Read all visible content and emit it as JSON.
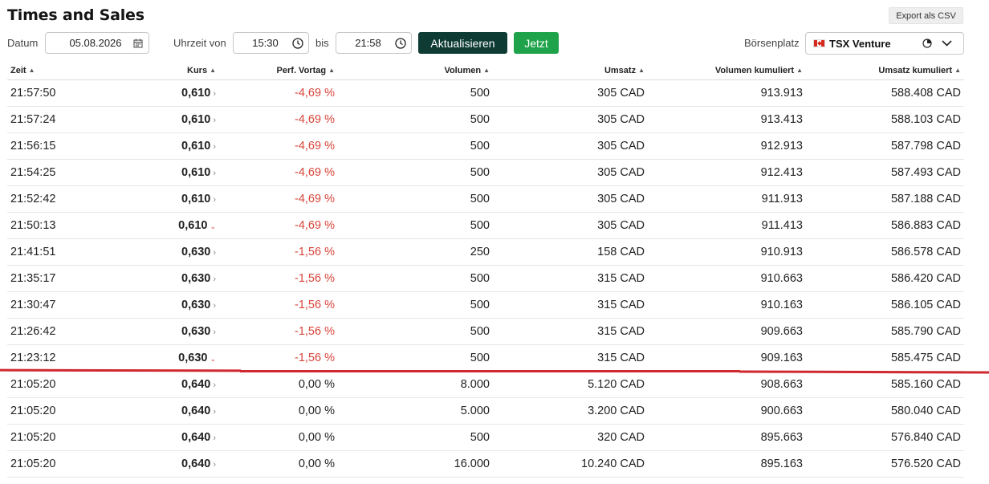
{
  "title": "Times and Sales",
  "export_label": "Export als CSV",
  "filters": {
    "date_label": "Datum",
    "date_value": "05.08.2026",
    "time_from_label": "Uhrzeit von",
    "time_from_value": "15:30",
    "time_to_label": "bis",
    "time_to_value": "21:58",
    "refresh_label": "Aktualisieren",
    "now_label": "Jetzt",
    "exchange_label": "Börsenplatz",
    "exchange_value": "TSX Venture"
  },
  "table": {
    "headers": [
      "Zeit",
      "Kurs",
      "Perf. Vortag",
      "Volumen",
      "Umsatz",
      "Volumen kumuliert",
      "Umsatz kumuliert"
    ],
    "rows": [
      {
        "zeit": "21:57:50",
        "kurs": "0,610",
        "trend": "neutral",
        "perf": "-4,69 %",
        "vol": "500",
        "umsatz": "305 CAD",
        "vol_kum": "913.913",
        "umsatz_kum": "588.408 CAD"
      },
      {
        "zeit": "21:57:24",
        "kurs": "0,610",
        "trend": "neutral",
        "perf": "-4,69 %",
        "vol": "500",
        "umsatz": "305 CAD",
        "vol_kum": "913.413",
        "umsatz_kum": "588.103 CAD"
      },
      {
        "zeit": "21:56:15",
        "kurs": "0,610",
        "trend": "neutral",
        "perf": "-4,69 %",
        "vol": "500",
        "umsatz": "305 CAD",
        "vol_kum": "912.913",
        "umsatz_kum": "587.798 CAD"
      },
      {
        "zeit": "21:54:25",
        "kurs": "0,610",
        "trend": "neutral",
        "perf": "-4,69 %",
        "vol": "500",
        "umsatz": "305 CAD",
        "vol_kum": "912.413",
        "umsatz_kum": "587.493 CAD"
      },
      {
        "zeit": "21:52:42",
        "kurs": "0,610",
        "trend": "neutral",
        "perf": "-4,69 %",
        "vol": "500",
        "umsatz": "305 CAD",
        "vol_kum": "911.913",
        "umsatz_kum": "587.188 CAD"
      },
      {
        "zeit": "21:50:13",
        "kurs": "0,610",
        "trend": "down",
        "perf": "-4,69 %",
        "vol": "500",
        "umsatz": "305 CAD",
        "vol_kum": "911.413",
        "umsatz_kum": "586.883 CAD"
      },
      {
        "zeit": "21:41:51",
        "kurs": "0,630",
        "trend": "neutral",
        "perf": "-1,56 %",
        "vol": "250",
        "umsatz": "158 CAD",
        "vol_kum": "910.913",
        "umsatz_kum": "586.578 CAD"
      },
      {
        "zeit": "21:35:17",
        "kurs": "0,630",
        "trend": "neutral",
        "perf": "-1,56 %",
        "vol": "500",
        "umsatz": "315 CAD",
        "vol_kum": "910.663",
        "umsatz_kum": "586.420 CAD"
      },
      {
        "zeit": "21:30:47",
        "kurs": "0,630",
        "trend": "neutral",
        "perf": "-1,56 %",
        "vol": "500",
        "umsatz": "315 CAD",
        "vol_kum": "910.163",
        "umsatz_kum": "586.105 CAD"
      },
      {
        "zeit": "21:26:42",
        "kurs": "0,630",
        "trend": "neutral",
        "perf": "-1,56 %",
        "vol": "500",
        "umsatz": "315 CAD",
        "vol_kum": "909.663",
        "umsatz_kum": "585.790 CAD"
      },
      {
        "zeit": "21:23:12",
        "kurs": "0,630",
        "trend": "down",
        "perf": "-1,56 %",
        "vol": "500",
        "umsatz": "315 CAD",
        "vol_kum": "909.163",
        "umsatz_kum": "585.475 CAD"
      },
      {
        "zeit": "21:05:20",
        "kurs": "0,640",
        "trend": "neutral",
        "perf": "0,00 %",
        "vol": "8.000",
        "umsatz": "5.120 CAD",
        "vol_kum": "908.663",
        "umsatz_kum": "585.160 CAD"
      },
      {
        "zeit": "21:05:20",
        "kurs": "0,640",
        "trend": "neutral",
        "perf": "0,00 %",
        "vol": "5.000",
        "umsatz": "3.200 CAD",
        "vol_kum": "900.663",
        "umsatz_kum": "580.040 CAD"
      },
      {
        "zeit": "21:05:20",
        "kurs": "0,640",
        "trend": "neutral",
        "perf": "0,00 %",
        "vol": "500",
        "umsatz": "320 CAD",
        "vol_kum": "895.663",
        "umsatz_kum": "576.840 CAD"
      },
      {
        "zeit": "21:05:20",
        "kurs": "0,640",
        "trend": "neutral",
        "perf": "0,00 %",
        "vol": "16.000",
        "umsatz": "10.240 CAD",
        "vol_kum": "895.163",
        "umsatz_kum": "576.520 CAD"
      }
    ]
  },
  "colors": {
    "negative": "#d9443a",
    "refresh_bg": "#0e3b34",
    "now_bg": "#1ea34a",
    "annotation_line": "#d0282f"
  },
  "icons": {
    "date_field": "calendar-icon",
    "time_fields": "clock-icon",
    "exchange_flag": "canada-flag-icon",
    "exchange_status": "market-status-icon",
    "exchange_dropdown": "chevron-down-icon",
    "sort": "sort-arrows-icon",
    "row_trend_neutral": "chevron-right-icon",
    "row_trend_down": "chevron-down-icon"
  }
}
